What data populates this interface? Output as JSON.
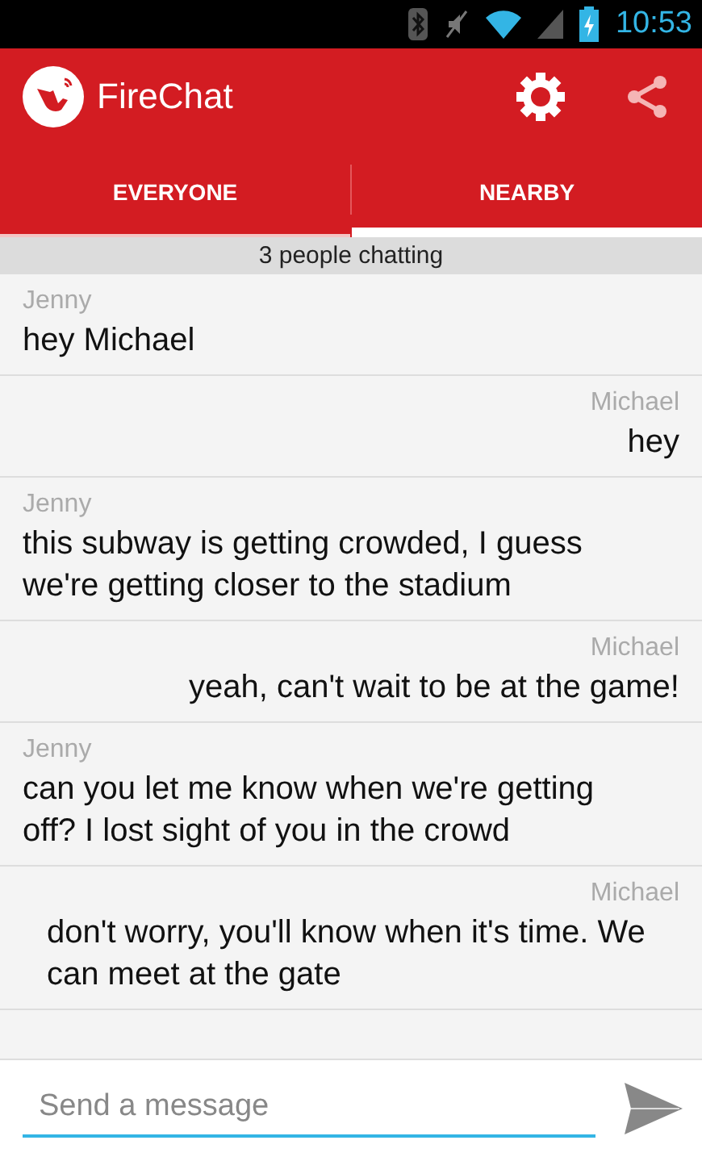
{
  "status_bar": {
    "time": "10:53"
  },
  "app_bar": {
    "title": "FireChat"
  },
  "tabs": [
    {
      "label": "EVERYONE",
      "selected": false
    },
    {
      "label": "NEARBY",
      "selected": true
    }
  ],
  "chatting_count": "3 people chatting",
  "messages": [
    {
      "sender": "Jenny",
      "kind": "incoming",
      "text": "hey Michael"
    },
    {
      "sender": "Michael",
      "kind": "outgoing",
      "text": "hey"
    },
    {
      "sender": "Jenny",
      "kind": "incoming",
      "text": "this subway is getting crowded, I guess we're getting closer to the stadium"
    },
    {
      "sender": "Michael",
      "kind": "outgoing",
      "text": "yeah, can't wait to be at the game!"
    },
    {
      "sender": "Jenny",
      "kind": "incoming",
      "text": "can you let me know when we're getting off? I lost sight of you in the crowd"
    },
    {
      "sender": "Michael",
      "kind": "outgoing",
      "text": "don't worry, you'll know when it's time. We can meet at the gate"
    }
  ],
  "composer": {
    "placeholder": "Send a message"
  }
}
